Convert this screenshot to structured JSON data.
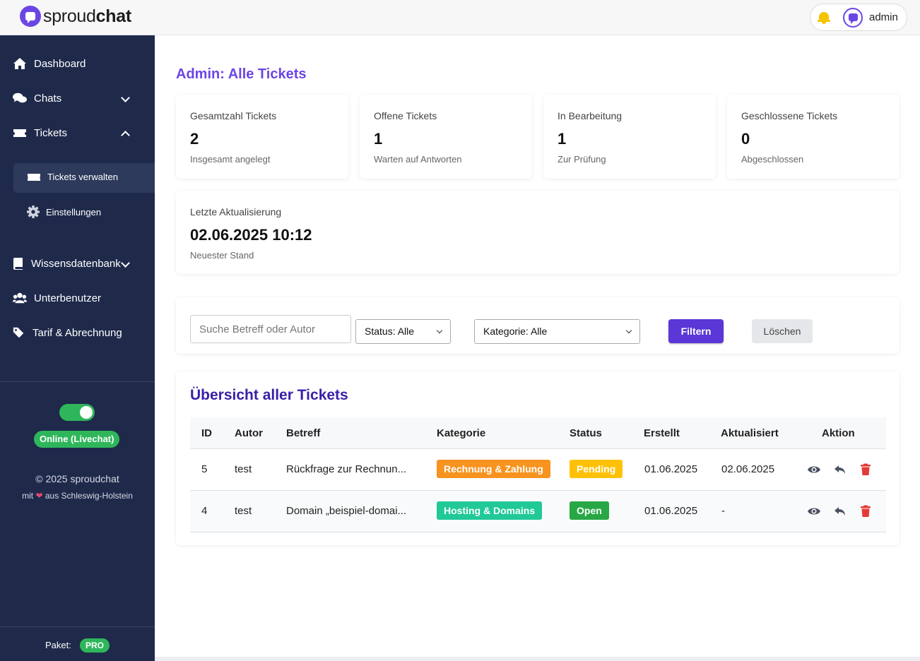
{
  "brand": {
    "name_light": "sproud",
    "name_bold": "chat"
  },
  "topbar": {
    "username": "admin"
  },
  "sidebar": {
    "items": [
      {
        "label": "Dashboard",
        "icon": "home-icon"
      },
      {
        "label": "Chats",
        "icon": "chats-icon",
        "expanded": false
      },
      {
        "label": "Tickets",
        "icon": "ticket-icon",
        "expanded": true
      },
      {
        "label": "Wissensdatenbank",
        "icon": "book-icon",
        "expanded": false
      },
      {
        "label": "Unterbenutzer",
        "icon": "users-icon"
      },
      {
        "label": "Tarif & Abrechnung",
        "icon": "tags-icon"
      }
    ],
    "ticket_sub": [
      {
        "label": "Tickets verwalten",
        "icon": "ticket-icon",
        "active": true
      },
      {
        "label": "Einstellungen",
        "icon": "gear-icon"
      }
    ],
    "online_label": "Online (Livechat)",
    "copyright": "© 2025 sproudchat",
    "made_prefix": "mit",
    "made_suffix": "aus Schleswig-Holstein",
    "package_label": "Paket:",
    "package_value": "PRO"
  },
  "page": {
    "title": "Admin: Alle Tickets"
  },
  "stats": [
    {
      "label": "Gesamtzahl Tickets",
      "value": "2",
      "sub": "Insgesamt angelegt"
    },
    {
      "label": "Offene Tickets",
      "value": "1",
      "sub": "Warten auf Antworten"
    },
    {
      "label": "In Bearbeitung",
      "value": "1",
      "sub": "Zur Prüfung"
    },
    {
      "label": "Geschlossene Tickets",
      "value": "0",
      "sub": "Abgeschlossen"
    }
  ],
  "last_update": {
    "label": "Letzte Aktualisierung",
    "value": "02.06.2025 10:12",
    "sub": "Neuester Stand"
  },
  "filter": {
    "search_placeholder": "Suche Betreff oder Autor",
    "status_select": "Status: Alle",
    "category_select": "Kategorie: Alle",
    "filter_button": "Filtern",
    "clear_button": "Löschen"
  },
  "table": {
    "title": "Übersicht aller Tickets",
    "headers": [
      "ID",
      "Autor",
      "Betreff",
      "Kategorie",
      "Status",
      "Erstellt",
      "Aktualisiert",
      "Aktion"
    ],
    "rows": [
      {
        "id": "5",
        "author": "test",
        "subject": "Rückfrage zur Rechnun...",
        "category": "Rechnung & Zahlung",
        "category_color": "#f7931e",
        "status": "Pending",
        "status_color": "#ffc107",
        "created": "01.06.2025",
        "updated": "02.06.2025"
      },
      {
        "id": "4",
        "author": "test",
        "subject": "Domain „beispiel-domai...",
        "category": "Hosting & Domains",
        "category_color": "#20c997",
        "status": "Open",
        "status_color": "#28a745",
        "created": "01.06.2025",
        "updated": "-"
      }
    ]
  },
  "colors": {
    "accent": "#6b46e5",
    "sidebar": "#1f2a4b",
    "success": "#2fb65b",
    "danger": "#e53935"
  }
}
